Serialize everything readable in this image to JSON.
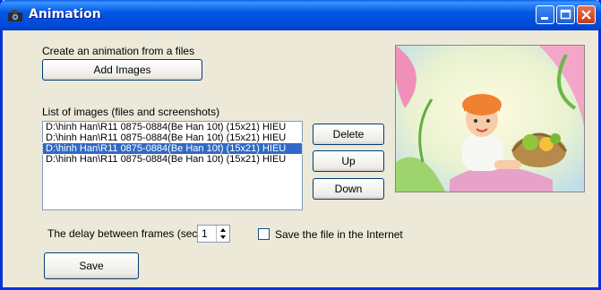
{
  "window": {
    "title": "Animation",
    "icon": "camera-icon"
  },
  "section": {
    "create_label": "Create an animation from a files",
    "add_images_label": "Add Images",
    "list_label": "List of images (files and screenshots)"
  },
  "images": [
    "D:\\hinh Han\\R11 0875-0884(Be Han 10t) (15x21) HIEU",
    "D:\\hinh Han\\R11 0875-0884(Be Han 10t) (15x21) HIEU",
    "D:\\hinh Han\\R11 0875-0884(Be Han 10t) (15x21) HIEU",
    "D:\\hinh Han\\R11 0875-0884(Be Han 10t) (15x21) HIEU"
  ],
  "selected_index": 2,
  "buttons": {
    "delete": "Delete",
    "up": "Up",
    "down": "Down",
    "save": "Save"
  },
  "delay": {
    "label": "The delay between frames (sec)",
    "value": "1"
  },
  "internet": {
    "label": "Save the file in the Internet",
    "checked": false
  },
  "preview": {
    "alt": "Preview of a child sitting by a fruit basket"
  }
}
